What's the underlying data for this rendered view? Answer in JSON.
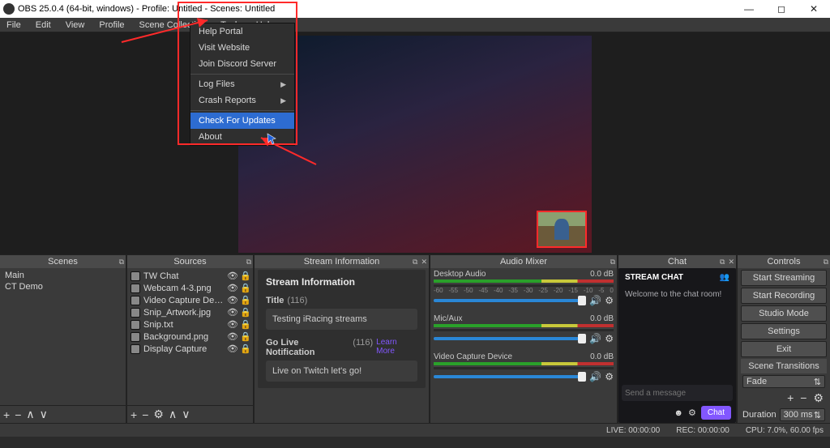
{
  "title": "OBS 25.0.4 (64-bit, windows) - Profile: Untitled - Scenes: Untitled",
  "menu": [
    "File",
    "Edit",
    "View",
    "Profile",
    "Scene Collection",
    "Tools",
    "Help"
  ],
  "help_menu": {
    "items": [
      {
        "label": "Help Portal",
        "sub": false
      },
      {
        "label": "Visit Website",
        "sub": false
      },
      {
        "label": "Join Discord Server",
        "sub": false
      },
      {
        "sep": true
      },
      {
        "label": "Log Files",
        "sub": true
      },
      {
        "label": "Crash Reports",
        "sub": true
      },
      {
        "sep": true
      },
      {
        "label": "Check For Updates",
        "sub": false,
        "highlight": true
      },
      {
        "label": "About",
        "sub": false
      }
    ]
  },
  "scenes": {
    "header": "Scenes",
    "items": [
      "Main",
      "CT Demo"
    ]
  },
  "sources": {
    "header": "Sources",
    "items": [
      "TW Chat",
      "Webcam 4-3.png",
      "Video Capture Device",
      "Snip_Artwork.jpg",
      "Snip.txt",
      "Background.png",
      "Display Capture"
    ]
  },
  "stream_info": {
    "header": "Stream Information",
    "panel_title": "Stream Information",
    "title_label": "Title",
    "title_count": "(116)",
    "title_value": "Testing iRacing streams",
    "golive_label": "Go Live Notification",
    "golive_count": "(116)",
    "golive_value": "Live on Twitch let's go!",
    "learn": "Learn More"
  },
  "mixer": {
    "header": "Audio Mixer",
    "ticks": [
      "-60",
      "-55",
      "-50",
      "-45",
      "-40",
      "-35",
      "-30",
      "-25",
      "-20",
      "-15",
      "-10",
      "-5",
      "0"
    ],
    "channels": [
      {
        "name": "Desktop Audio",
        "db": "0.0 dB"
      },
      {
        "name": "Mic/Aux",
        "db": "0.0 dB"
      },
      {
        "name": "Video Capture Device",
        "db": "0.0 dB"
      }
    ]
  },
  "chat": {
    "header": "Chat",
    "title": "STREAM CHAT",
    "welcome": "Welcome to the chat room!",
    "placeholder": "Send a message",
    "button": "Chat"
  },
  "controls": {
    "header": "Controls",
    "buttons": [
      "Start Streaming",
      "Start Recording",
      "Studio Mode",
      "Settings",
      "Exit"
    ],
    "transitions_header": "Scene Transitions",
    "transition": "Fade",
    "duration_label": "Duration",
    "duration_value": "300 ms"
  },
  "status": {
    "live": "LIVE: 00:00:00",
    "rec": "REC: 00:00:00",
    "cpu": "CPU: 7.0%, 60.00 fps"
  }
}
